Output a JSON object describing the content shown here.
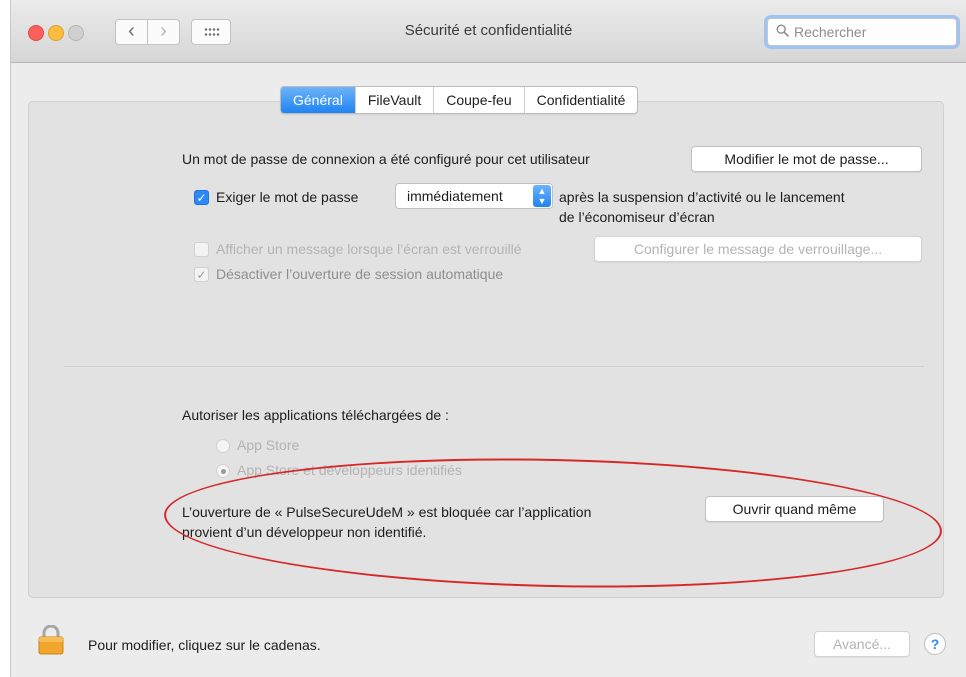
{
  "window": {
    "title": "Sécurité et confidentialité",
    "search_placeholder": "Rechercher",
    "nav_back": "‹",
    "nav_forward": "›"
  },
  "tabs": [
    {
      "label": "Général",
      "active": true
    },
    {
      "label": "FileVault",
      "active": false
    },
    {
      "label": "Coupe-feu",
      "active": false
    },
    {
      "label": "Confidentialité",
      "active": false
    }
  ],
  "general": {
    "password_text": "Un mot de passe de connexion a été configuré pour cet utilisateur",
    "change_password_button": "Modifier le mot de passe...",
    "require_password_label": "Exiger le mot de passe",
    "require_password_checked": true,
    "require_password_delay": "immédiatement",
    "require_password_after_line1": "après la suspension d’activité ou le lancement",
    "require_password_after_line2": "de l’économiseur d’écran",
    "show_message_label": "Afficher un message lorsque l’écran est verrouillé",
    "show_message_checked": false,
    "configure_message_button": "Configurer le message de verrouillage...",
    "disable_autologin_label": "Désactiver l’ouverture de session automatique",
    "disable_autologin_checked": true
  },
  "downloads": {
    "heading": "Autoriser les applications téléchargées de :",
    "options": [
      {
        "label": "App Store",
        "selected": false
      },
      {
        "label": "App Store et développeurs identifiés",
        "selected": true
      }
    ],
    "blocked_line1": "L’ouverture de « PulseSecureUdeM » est bloquée car l’application",
    "blocked_line2": "provient d’un développeur non identifié.",
    "open_anyway_button": "Ouvrir quand même"
  },
  "footer": {
    "lock_text": "Pour modifier, cliquez sur le cadenas.",
    "advanced_button": "Avancé...",
    "help_label": "?"
  },
  "colors": {
    "accent": "#1f84f3",
    "annotation": "#d62828"
  }
}
